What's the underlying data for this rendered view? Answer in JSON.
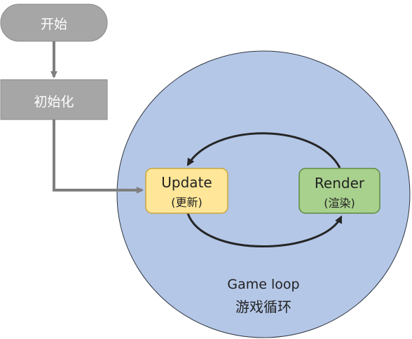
{
  "start": {
    "label": "开始"
  },
  "init": {
    "label": "初始化"
  },
  "update": {
    "label": "Update",
    "sublabel": "(更新)"
  },
  "render": {
    "label": "Render",
    "sublabel": "(渲染)"
  },
  "loop": {
    "title": "Game loop",
    "subtitle": "游戏循环"
  },
  "colors": {
    "gray_node": "#a6a6a6",
    "gray_border": "#8a8a8a",
    "gray_arrow": "#7f7f7f",
    "loop_fill": "#b4c7e7",
    "loop_stroke": "#2f3540",
    "update_fill": "#ffe699",
    "update_stroke": "#c9a53a",
    "render_fill": "#a9d18e",
    "render_stroke": "#5e8a40",
    "cycle_arrow": "#262626"
  }
}
